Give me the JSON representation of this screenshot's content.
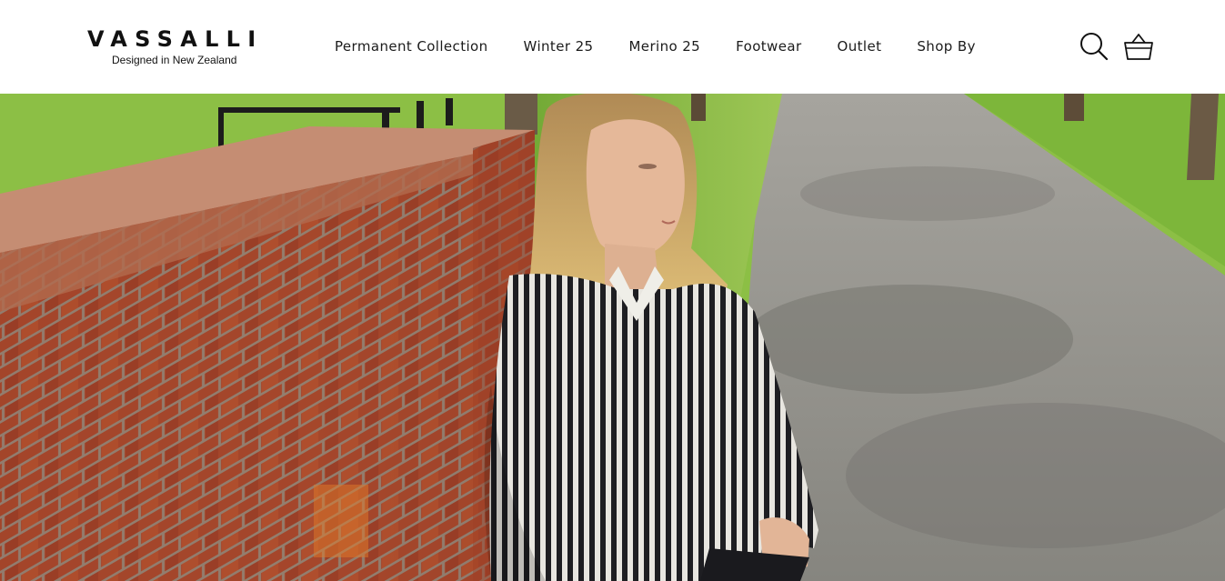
{
  "header": {
    "logo": {
      "wordmark": "VASSALLI",
      "tagline": "Designed in New Zealand"
    },
    "nav": [
      {
        "label": "Permanent Collection"
      },
      {
        "label": "Winter 25"
      },
      {
        "label": "Merino 25"
      },
      {
        "label": "Footwear"
      },
      {
        "label": "Outlet"
      },
      {
        "label": "Shop By"
      }
    ],
    "icons": {
      "search": "search-icon",
      "cart": "basket-icon"
    }
  },
  "hero": {
    "image": "woman-in-striped-shirt-leaning-on-brick-wall",
    "colors": {
      "brick": "#a4462b",
      "grass": "#7fb83c",
      "road": "#8d8c87",
      "stripe_dark": "#1e1e22",
      "hair": "#c9a15e"
    }
  }
}
